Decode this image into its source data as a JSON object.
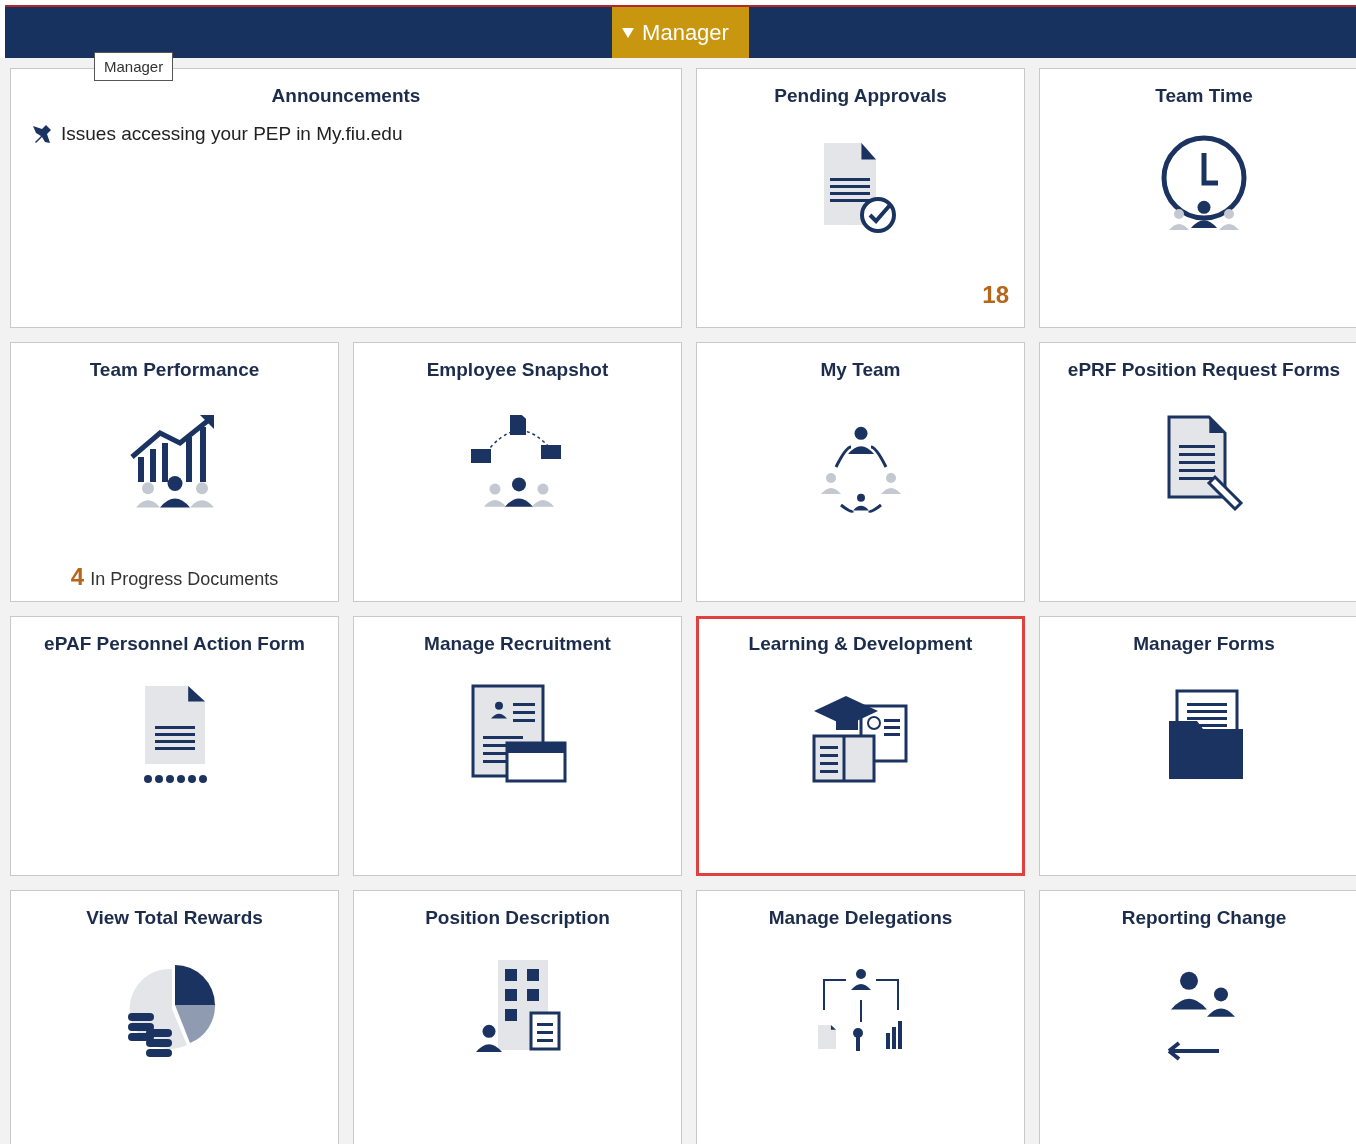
{
  "header": {
    "tab": {
      "label": "Manager",
      "expanded": true
    }
  },
  "tooltip": "Manager",
  "tiles": [
    {
      "kind": "announcements",
      "title": "Announcements",
      "selected": false,
      "items": [
        "Issues accessing your PEP in My.fiu.edu"
      ]
    },
    {
      "kind": "icon",
      "title": "Pending Approvals",
      "selected": false,
      "count": "18"
    },
    {
      "kind": "icon",
      "title": "Team Time",
      "selected": false
    },
    {
      "kind": "icon",
      "title": "Team Performance",
      "selected": false,
      "count": "4",
      "count_label": "In Progress Documents"
    },
    {
      "kind": "icon",
      "title": "Employee Snapshot",
      "selected": false
    },
    {
      "kind": "icon",
      "title": "My Team",
      "selected": false
    },
    {
      "kind": "icon",
      "title": "ePRF Position Request Forms",
      "selected": false
    },
    {
      "kind": "icon",
      "title": "ePAF Personnel Action Form",
      "selected": false
    },
    {
      "kind": "icon",
      "title": "Manage Recruitment",
      "selected": false
    },
    {
      "kind": "icon",
      "title": "Learning & Development",
      "selected": true
    },
    {
      "kind": "icon",
      "title": "Manager Forms",
      "selected": false
    },
    {
      "kind": "icon",
      "title": "View Total Rewards",
      "selected": false
    },
    {
      "kind": "icon",
      "title": "Position Description",
      "selected": false
    },
    {
      "kind": "icon",
      "title": "Manage Delegations",
      "selected": false
    },
    {
      "kind": "icon",
      "title": "Reporting Change",
      "selected": false
    }
  ]
}
